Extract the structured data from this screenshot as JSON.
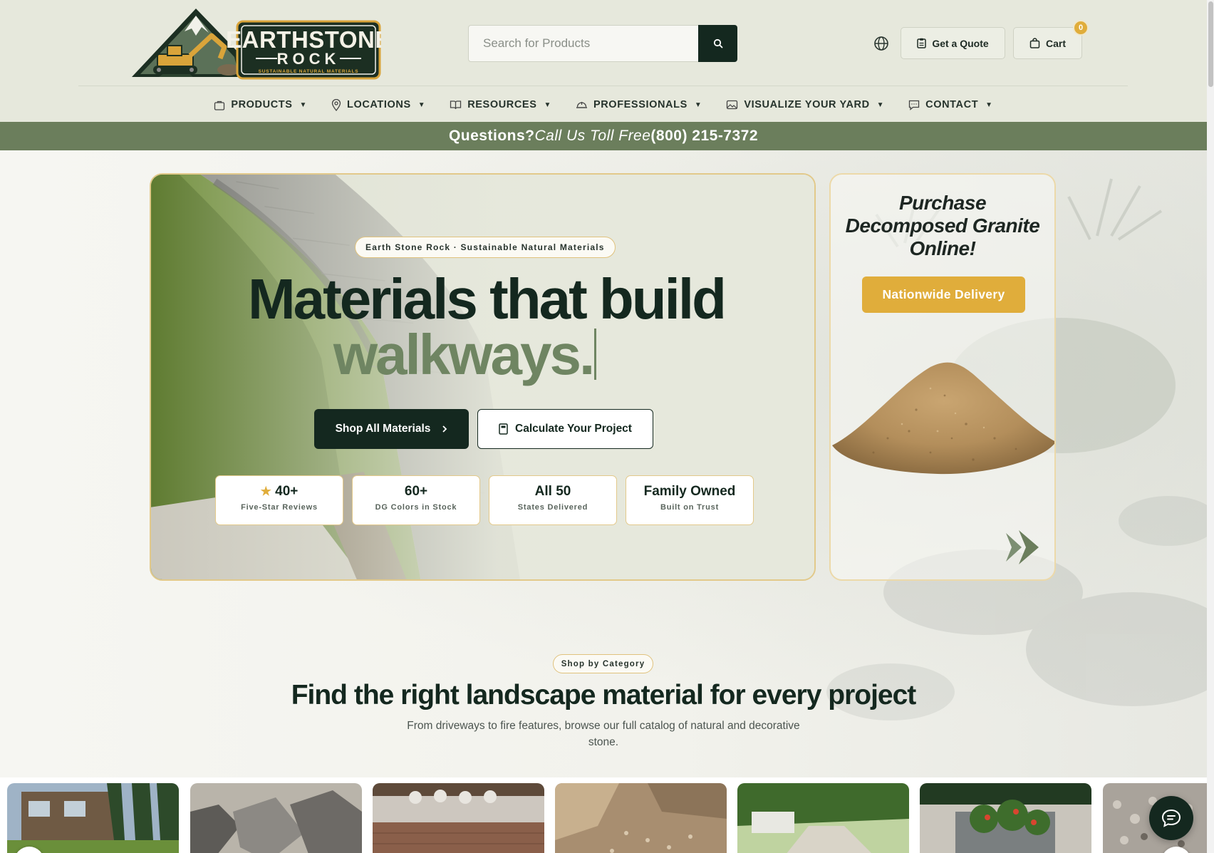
{
  "brand": {
    "logo_line1": "EARTHSTONE",
    "logo_line2": "ROCK",
    "logo_tagline": "SUSTAINABLE NATURAL MATERIALS"
  },
  "search": {
    "placeholder": "Search for Products"
  },
  "header": {
    "quote_label": "Get a Quote",
    "cart_label": "Cart",
    "cart_count": "0"
  },
  "nav": {
    "items": [
      {
        "label": "PRODUCTS",
        "icon": "bag-icon"
      },
      {
        "label": "LOCATIONS",
        "icon": "map-pin-icon"
      },
      {
        "label": "RESOURCES",
        "icon": "book-icon"
      },
      {
        "label": "PROFESSIONALS",
        "icon": "helmet-icon"
      },
      {
        "label": "VISUALIZE YOUR YARD",
        "icon": "image-icon"
      },
      {
        "label": "CONTACT",
        "icon": "message-icon"
      }
    ]
  },
  "announcement": {
    "lead": "Questions?",
    "middle": "Call Us Toll Free",
    "phone": "(800) 215-7372"
  },
  "hero": {
    "eyebrow": "Earth Stone Rock · Sustainable Natural Materials",
    "headline_line1": "Materials that build",
    "headline_line2": "walkways.",
    "primary_cta": "Shop All Materials",
    "secondary_cta": "Calculate Your Project",
    "stats": [
      {
        "value": "40+",
        "caption": "Five-Star Reviews"
      },
      {
        "value": "60+",
        "caption": "DG Colors in Stock"
      },
      {
        "value": "All 50",
        "caption": "States Delivered"
      },
      {
        "value": "Family Owned",
        "caption": "Built on Trust"
      }
    ]
  },
  "promo": {
    "title": "Purchase Decomposed Granite Online!",
    "button": "Nationwide Delivery"
  },
  "categories": {
    "eyebrow": "Shop by Category",
    "title": "Find the right landscape material for every project",
    "subtitle": "From driveways to fire features, browse our full catalog of natural and decorative stone."
  },
  "colors": {
    "brand_dark": "#14281f",
    "accent_gold": "#e0ad3b",
    "sage": "#6b7e5c",
    "header_bg": "#e6e8dc"
  }
}
